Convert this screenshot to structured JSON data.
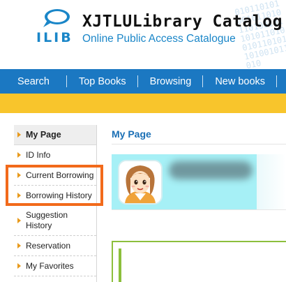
{
  "header": {
    "logo_text": "ILIB",
    "title": "XJTLULibrary Catalog",
    "subtitle": "Online Public Access Catalogue"
  },
  "nav": {
    "items": [
      {
        "label": "Search"
      },
      {
        "label": "Top Books"
      },
      {
        "label": "Browsing"
      },
      {
        "label": "New books"
      }
    ]
  },
  "sidebar": {
    "items": [
      {
        "label": "My Page",
        "active": true
      },
      {
        "label": "ID Info"
      },
      {
        "label": "Current Borrowing"
      },
      {
        "label": "Borrowing History"
      },
      {
        "label": "Suggestion History"
      },
      {
        "label": "Reservation"
      },
      {
        "label": "My Favorites"
      }
    ],
    "highlighted_items": [
      "Current Borrowing",
      "Borrowing History"
    ]
  },
  "main": {
    "title": "My Page"
  },
  "colors": {
    "nav_blue": "#1b78c2",
    "accent_yellow": "#f8c52c",
    "highlight_orange": "#f26a1b",
    "title_blue": "#1a6fb5",
    "card_cyan": "#a6f0f6",
    "box_green": "#8cbf3c"
  },
  "icons": [
    "speech-bubble-logo-icon",
    "arrow-right-icon",
    "avatar-icon"
  ]
}
